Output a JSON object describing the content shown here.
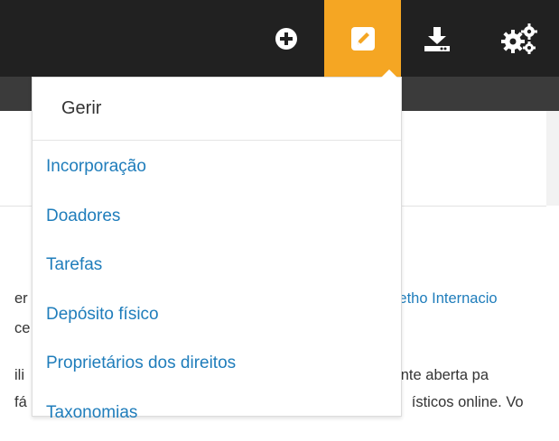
{
  "topbar": {
    "icons": [
      "add-icon",
      "edit-icon",
      "import-icon",
      "settings-icon"
    ],
    "active_color": "#f5a623",
    "bg_color": "#212121"
  },
  "background": {
    "line1": {
      "a": "er",
      "b": "rsetho Internacio"
    },
    "line2": {
      "a": "ce"
    },
    "line3": {
      "a": "ili",
      "b": "fonte aberta pa"
    },
    "line4": {
      "a": "fá",
      "b": "ísticos online. Vo"
    }
  },
  "dropdown": {
    "header": "Gerir",
    "items": [
      {
        "label": "Incorporação"
      },
      {
        "label": "Doadores"
      },
      {
        "label": "Tarefas"
      },
      {
        "label": "Depósito físico"
      },
      {
        "label": "Proprietários dos direitos"
      },
      {
        "label": "Taxonomias"
      }
    ],
    "link_color": "#1f7dbb"
  }
}
